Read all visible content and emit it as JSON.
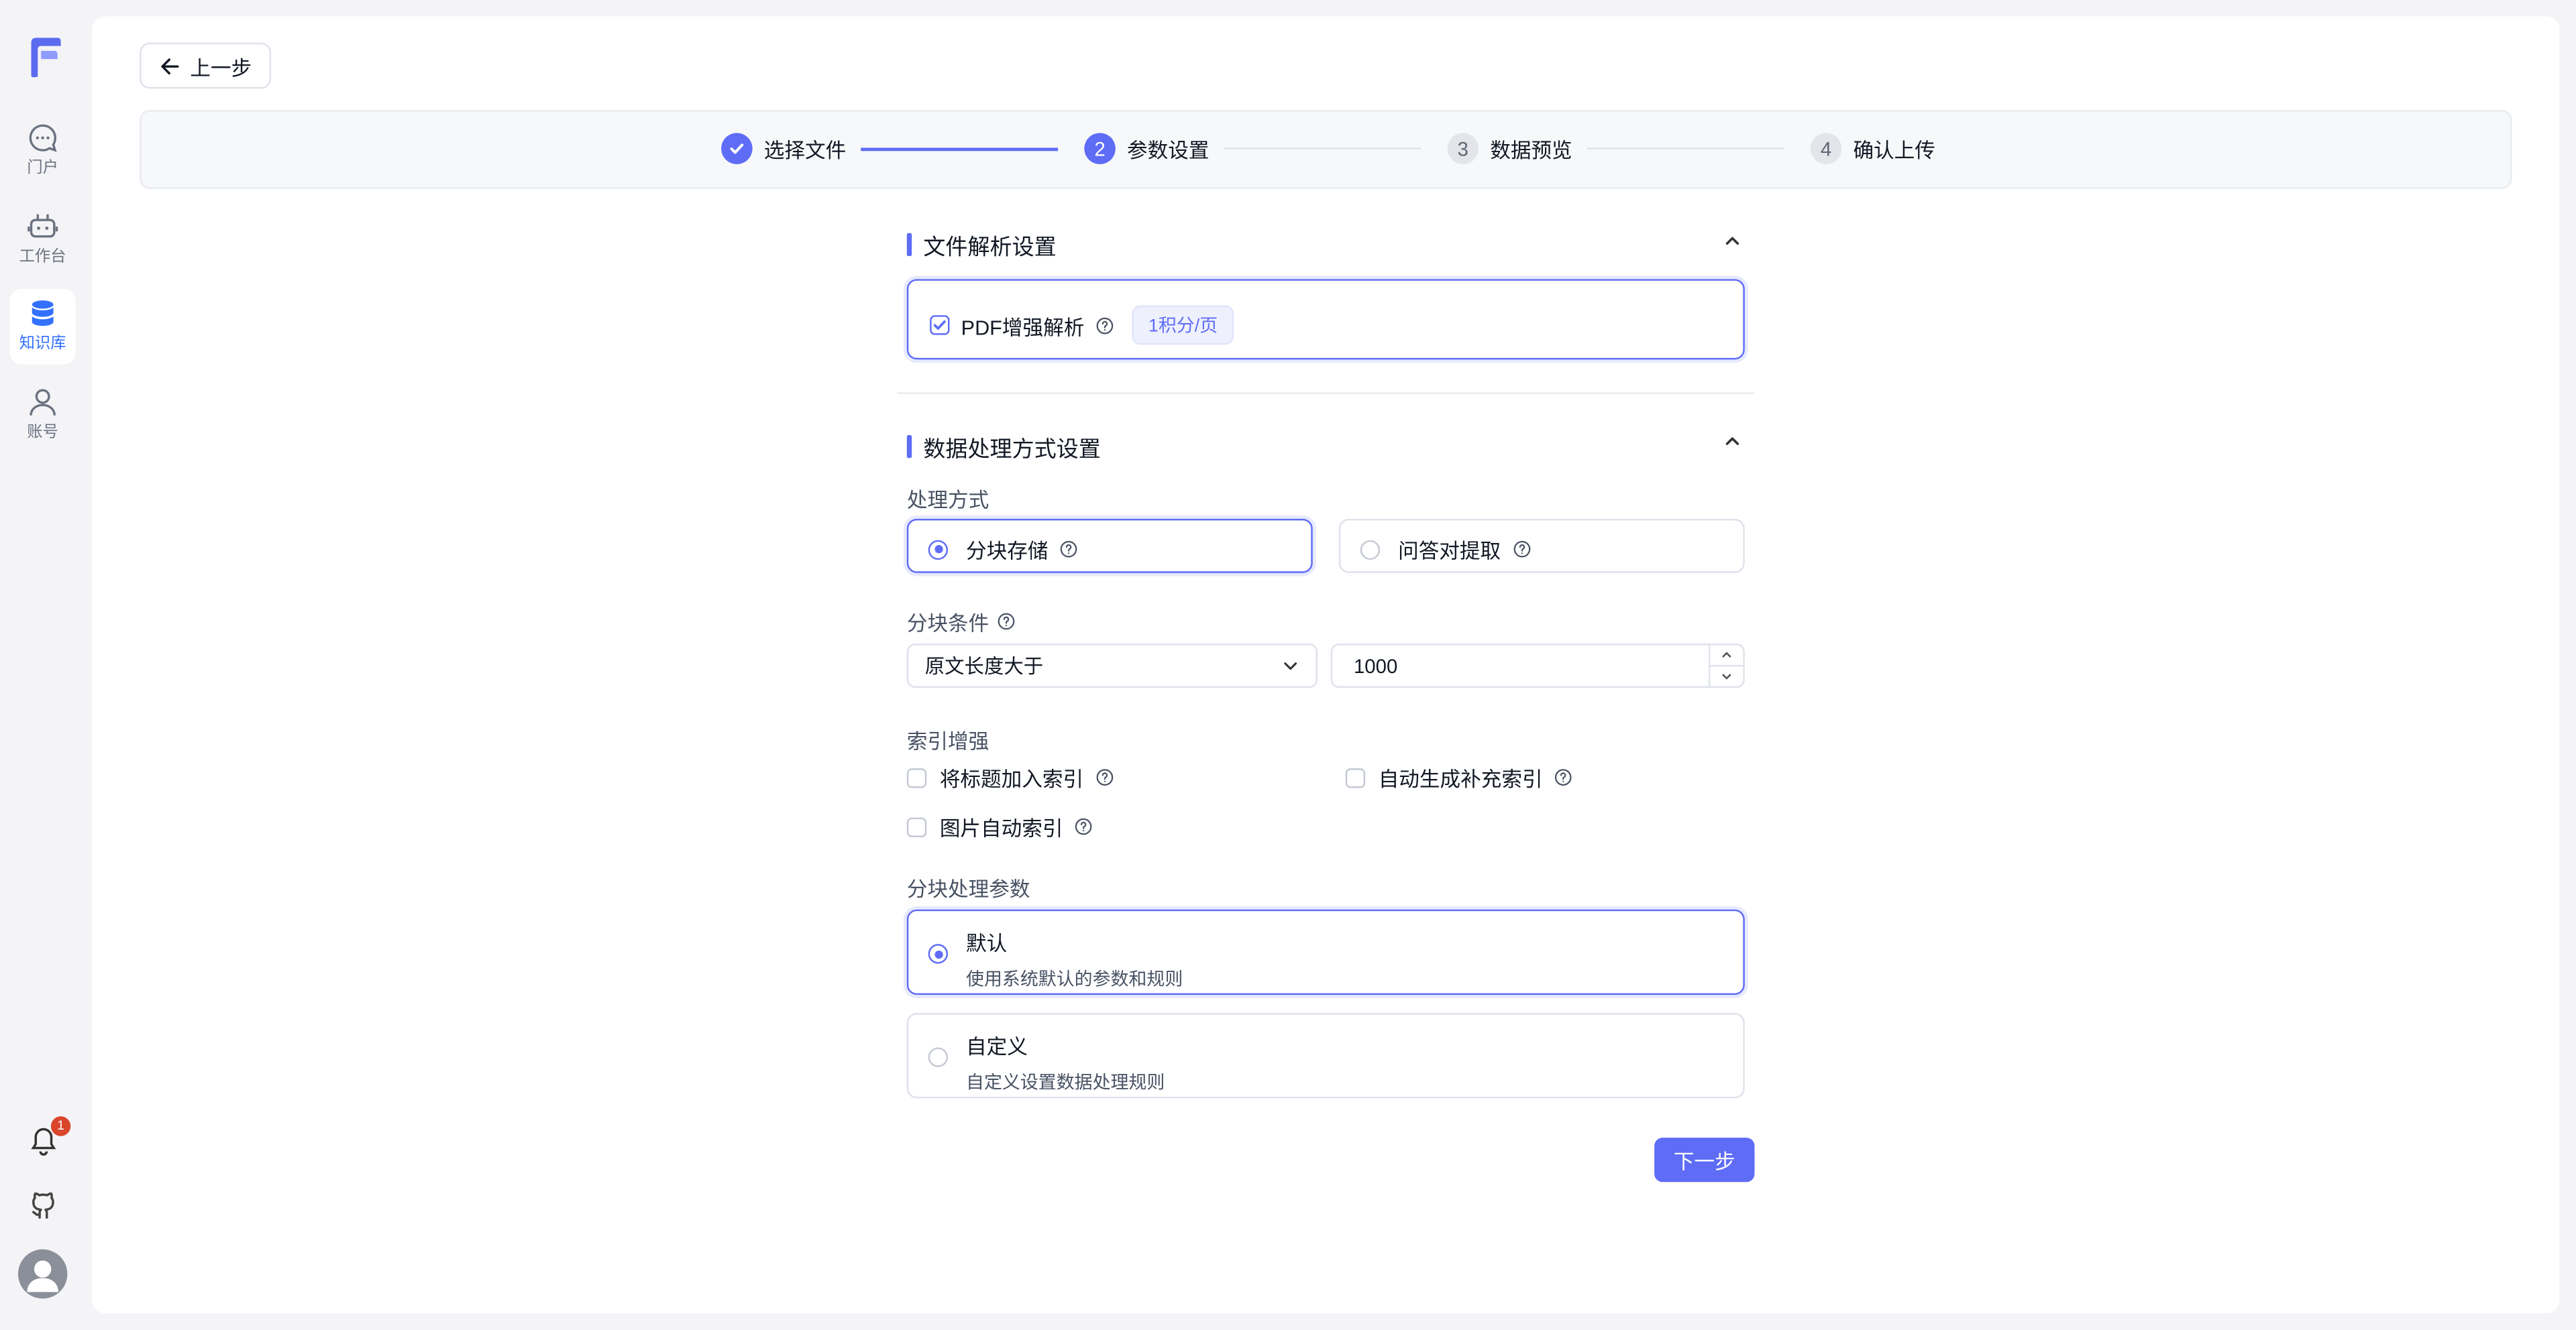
{
  "sidebar": {
    "items": [
      {
        "label": "门户",
        "icon": "chat-bubble-icon",
        "active": false
      },
      {
        "label": "工作台",
        "icon": "robot-icon",
        "active": false
      },
      {
        "label": "知识库",
        "icon": "database-icon",
        "active": true
      },
      {
        "label": "账号",
        "icon": "user-icon",
        "active": false
      }
    ],
    "notification_count": "1"
  },
  "header": {
    "back_label": "上一步"
  },
  "stepper": {
    "steps": [
      {
        "number": "1",
        "label": "选择文件",
        "status": "done"
      },
      {
        "number": "2",
        "label": "参数设置",
        "status": "current"
      },
      {
        "number": "3",
        "label": "数据预览",
        "status": "todo"
      },
      {
        "number": "4",
        "label": "确认上传",
        "status": "todo"
      }
    ]
  },
  "file_parse": {
    "title": "文件解析设置",
    "pdf_label": "PDF增强解析",
    "pdf_checked": true,
    "pdf_tag": "1积分/页"
  },
  "data_process": {
    "title": "数据处理方式设置",
    "mode_label": "处理方式",
    "modes": [
      {
        "label": "分块存储",
        "selected": true
      },
      {
        "label": "问答对提取",
        "selected": false
      }
    ],
    "chunk_condition_label": "分块条件",
    "chunk_condition_select": "原文长度大于",
    "chunk_condition_value": "1000",
    "index_label": "索引增强",
    "index_options": [
      {
        "label": "将标题加入索引",
        "checked": false
      },
      {
        "label": "自动生成补充索引",
        "checked": false
      },
      {
        "label": "图片自动索引",
        "checked": false
      }
    ],
    "param_label": "分块处理参数",
    "params": [
      {
        "title": "默认",
        "desc": "使用系统默认的参数和规则",
        "selected": true
      },
      {
        "title": "自定义",
        "desc": "自定义设置数据处理规则",
        "selected": false
      }
    ]
  },
  "footer": {
    "next_label": "下一步"
  },
  "colors": {
    "accent": "#5e6cf6",
    "badge": "#d9462b"
  }
}
